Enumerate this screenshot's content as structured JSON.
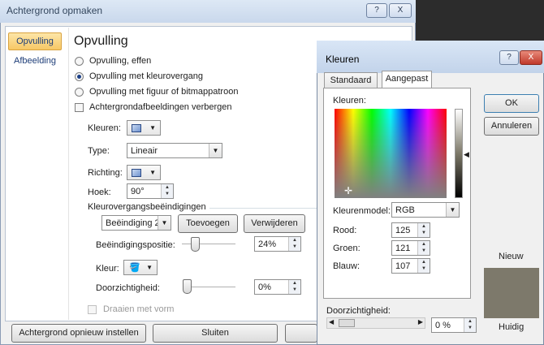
{
  "main_dialog": {
    "title": "Achtergrond opmaken",
    "title_btns": {
      "help": "?",
      "close": "X"
    },
    "nav": [
      {
        "label": "Opvulling"
      },
      {
        "label": "Afbeelding"
      }
    ],
    "heading": "Opvulling",
    "fill_options": [
      {
        "label": "Opvulling, effen",
        "selected": false
      },
      {
        "label": "Opvulling met kleurovergang",
        "selected": true
      },
      {
        "label": "Opvulling met figuur of bitmappatroon",
        "selected": false
      }
    ],
    "hide_bg_label": "Achtergrondafbeeldingen verbergen",
    "kleuren_label": "Kleuren:",
    "type_label": "Type:",
    "type_value": "Lineair",
    "richting_label": "Richting:",
    "hoek_label": "Hoek:",
    "hoek_value": "90°",
    "stops_group_label": "Kleurovergangsbeëindigingen",
    "stop_selected": "Beëindiging 2",
    "add_button": "Toevoegen",
    "remove_button": "Verwijderen",
    "position_label": "Beëindigingspositie:",
    "position_value": "24%",
    "position_fraction": 0.24,
    "kleur_label": "Kleur:",
    "transparency_label": "Doorzichtigheid:",
    "transparency_value": "0%",
    "rotate_label": "Draaien met vorm",
    "reset_button": "Achtergrond opnieuw instellen",
    "close_button": "Sluiten"
  },
  "colors_dialog": {
    "title": "Kleuren",
    "title_btns": {
      "help": "?",
      "close": "X"
    },
    "tabs": [
      {
        "label": "Standaard"
      },
      {
        "label": "Aangepast",
        "active": true
      }
    ],
    "kleuren_label": "Kleuren:",
    "model_label": "Kleurenmodel:",
    "model_value": "RGB",
    "red_label": "Rood:",
    "red_value": "125",
    "green_label": "Groen:",
    "green_value": "121",
    "blue_label": "Blauw:",
    "blue_value": "107",
    "transparency_label": "Doorzichtigheid:",
    "transparency_value": "0 %",
    "ok_button": "OK",
    "cancel_button": "Annuleren",
    "new_label": "Nieuw",
    "current_label": "Huidig",
    "current_color": "#7d796b"
  }
}
